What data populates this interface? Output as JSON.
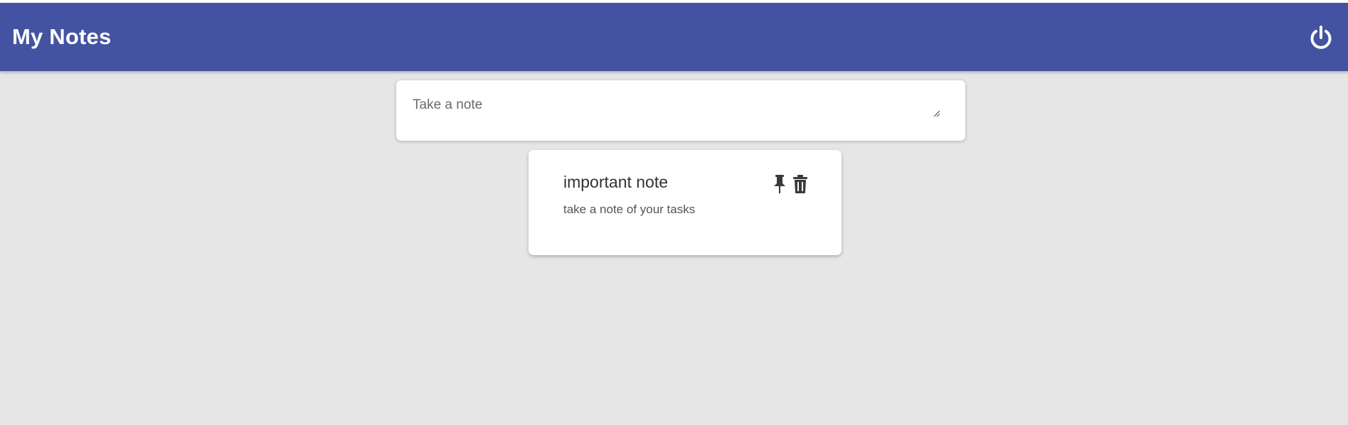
{
  "header": {
    "title": "My Notes",
    "logout_icon": "power-icon",
    "background_color": "#4453a1"
  },
  "compose": {
    "placeholder": "Take a note",
    "value": ""
  },
  "notes": [
    {
      "title": "important note",
      "content": "take a note of your tasks",
      "actions": [
        "pin-icon",
        "trash-icon"
      ]
    }
  ]
}
